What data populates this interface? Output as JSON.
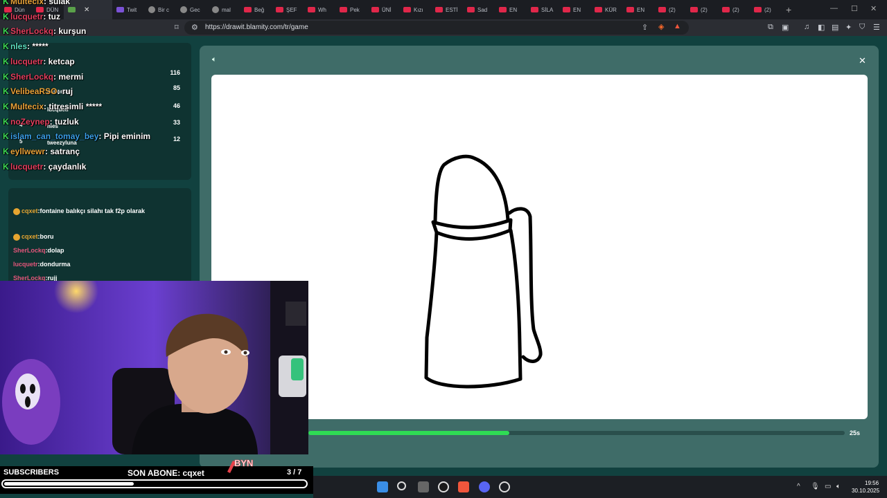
{
  "browser": {
    "tabs": [
      {
        "label": "Dün",
        "icon": "youtube-icon"
      },
      {
        "label": "DÜN",
        "icon": "youtube-icon"
      },
      {
        "label": "",
        "icon": "drawit-icon",
        "active": true
      },
      {
        "label": "Twit",
        "icon": "twitch-icon"
      },
      {
        "label": "Bir c",
        "icon": "globe-icon"
      },
      {
        "label": "Gec",
        "icon": "globe-icon"
      },
      {
        "label": "mal",
        "icon": "globe-icon"
      },
      {
        "label": "Beğ",
        "icon": "youtube-icon"
      },
      {
        "label": "ŞEF",
        "icon": "youtube-icon"
      },
      {
        "label": "Wh",
        "icon": "youtube-icon"
      },
      {
        "label": "Pek",
        "icon": "youtube-icon"
      },
      {
        "label": "ÜNİ",
        "icon": "youtube-icon"
      },
      {
        "label": "Kızı",
        "icon": "youtube-icon"
      },
      {
        "label": "ESTİ",
        "icon": "youtube-icon"
      },
      {
        "label": "Sad",
        "icon": "youtube-icon"
      },
      {
        "label": "EN",
        "icon": "youtube-icon"
      },
      {
        "label": "SİLA",
        "icon": "youtube-icon"
      },
      {
        "label": "EN",
        "icon": "youtube-icon"
      },
      {
        "label": "KÜR",
        "icon": "youtube-icon"
      },
      {
        "label": "EN",
        "icon": "youtube-icon"
      },
      {
        "label": "(2)",
        "icon": "youtube-icon"
      },
      {
        "label": "(2)",
        "icon": "youtube-icon"
      },
      {
        "label": "(2)",
        "icon": "youtube-icon"
      },
      {
        "label": "(2)",
        "icon": "youtube-icon"
      }
    ],
    "url": "https://drawit.blamity.com/tr/game"
  },
  "overlay_chat": [
    {
      "user": "Multecix",
      "msg": ": sulak",
      "color": "orange"
    },
    {
      "user": "lucquetr",
      "msg": ": tuz",
      "color": "pink"
    },
    {
      "user": "SherLockq",
      "msg": ": kurşun",
      "color": "pink"
    },
    {
      "user": "nles",
      "msg": ": *****",
      "color": "teal"
    },
    {
      "user": "lucquetr",
      "msg": ": ketcap",
      "color": "pink"
    },
    {
      "user": "SherLockq",
      "msg": ": mermi",
      "color": "pink"
    },
    {
      "user": "VelibeaRSO",
      "msg": ": ruj",
      "color": "orange"
    },
    {
      "user": "Multecix",
      "msg": ": titresimli *****",
      "color": "orange"
    },
    {
      "user": "noZeynep",
      "msg": ": tuzluk",
      "color": "pink"
    },
    {
      "user": "islam_can_tomay_bey",
      "msg": ": Pipi eminim",
      "color": "blue"
    },
    {
      "user": "eyllwewr",
      "msg": ": satranç",
      "color": "orange"
    },
    {
      "user": "lucquetr",
      "msg": ": çaydanlık",
      "color": "pink"
    }
  ],
  "scoreboard": [
    {
      "rank": "",
      "name": "",
      "points": "116"
    },
    {
      "rank": "",
      "name": "nattercat",
      "points": "85"
    },
    {
      "rank": "3",
      "name": "lucquetr",
      "points": "46"
    },
    {
      "rank": "4",
      "name": "nles",
      "points": "33"
    },
    {
      "rank": "5",
      "name": "tweezyluna",
      "points": "12"
    }
  ],
  "game_chat": [
    {
      "user": "cqxet",
      "msg": ":fontaine balıkçı silahı tak f2p olarak"
    },
    {
      "user": "cqxet",
      "msg": ":boru"
    },
    {
      "user": "SherLockq",
      "msg": ":dolap"
    },
    {
      "user": "lucquetr",
      "msg": ":dondurma"
    },
    {
      "user": "SherLockq",
      "msg": ":rujj"
    }
  ],
  "game": {
    "timer_text": "25s",
    "timer_progress": 0.375
  },
  "stream": {
    "subscribers_label": "SUBSCRIBERS",
    "son_abone": "SON ABONE: cqxet",
    "goal_count": "3  / 7",
    "goal_progress": 0.43,
    "logo_text": "BYN"
  },
  "taskbar": {
    "time": "19:56",
    "date": "30.10.2025"
  },
  "colors": {
    "board": "#3f6c68",
    "page": "#11413f",
    "timer": "#2fdc54",
    "username_pink": "#e3557a",
    "username_orange": "#e6a530"
  }
}
